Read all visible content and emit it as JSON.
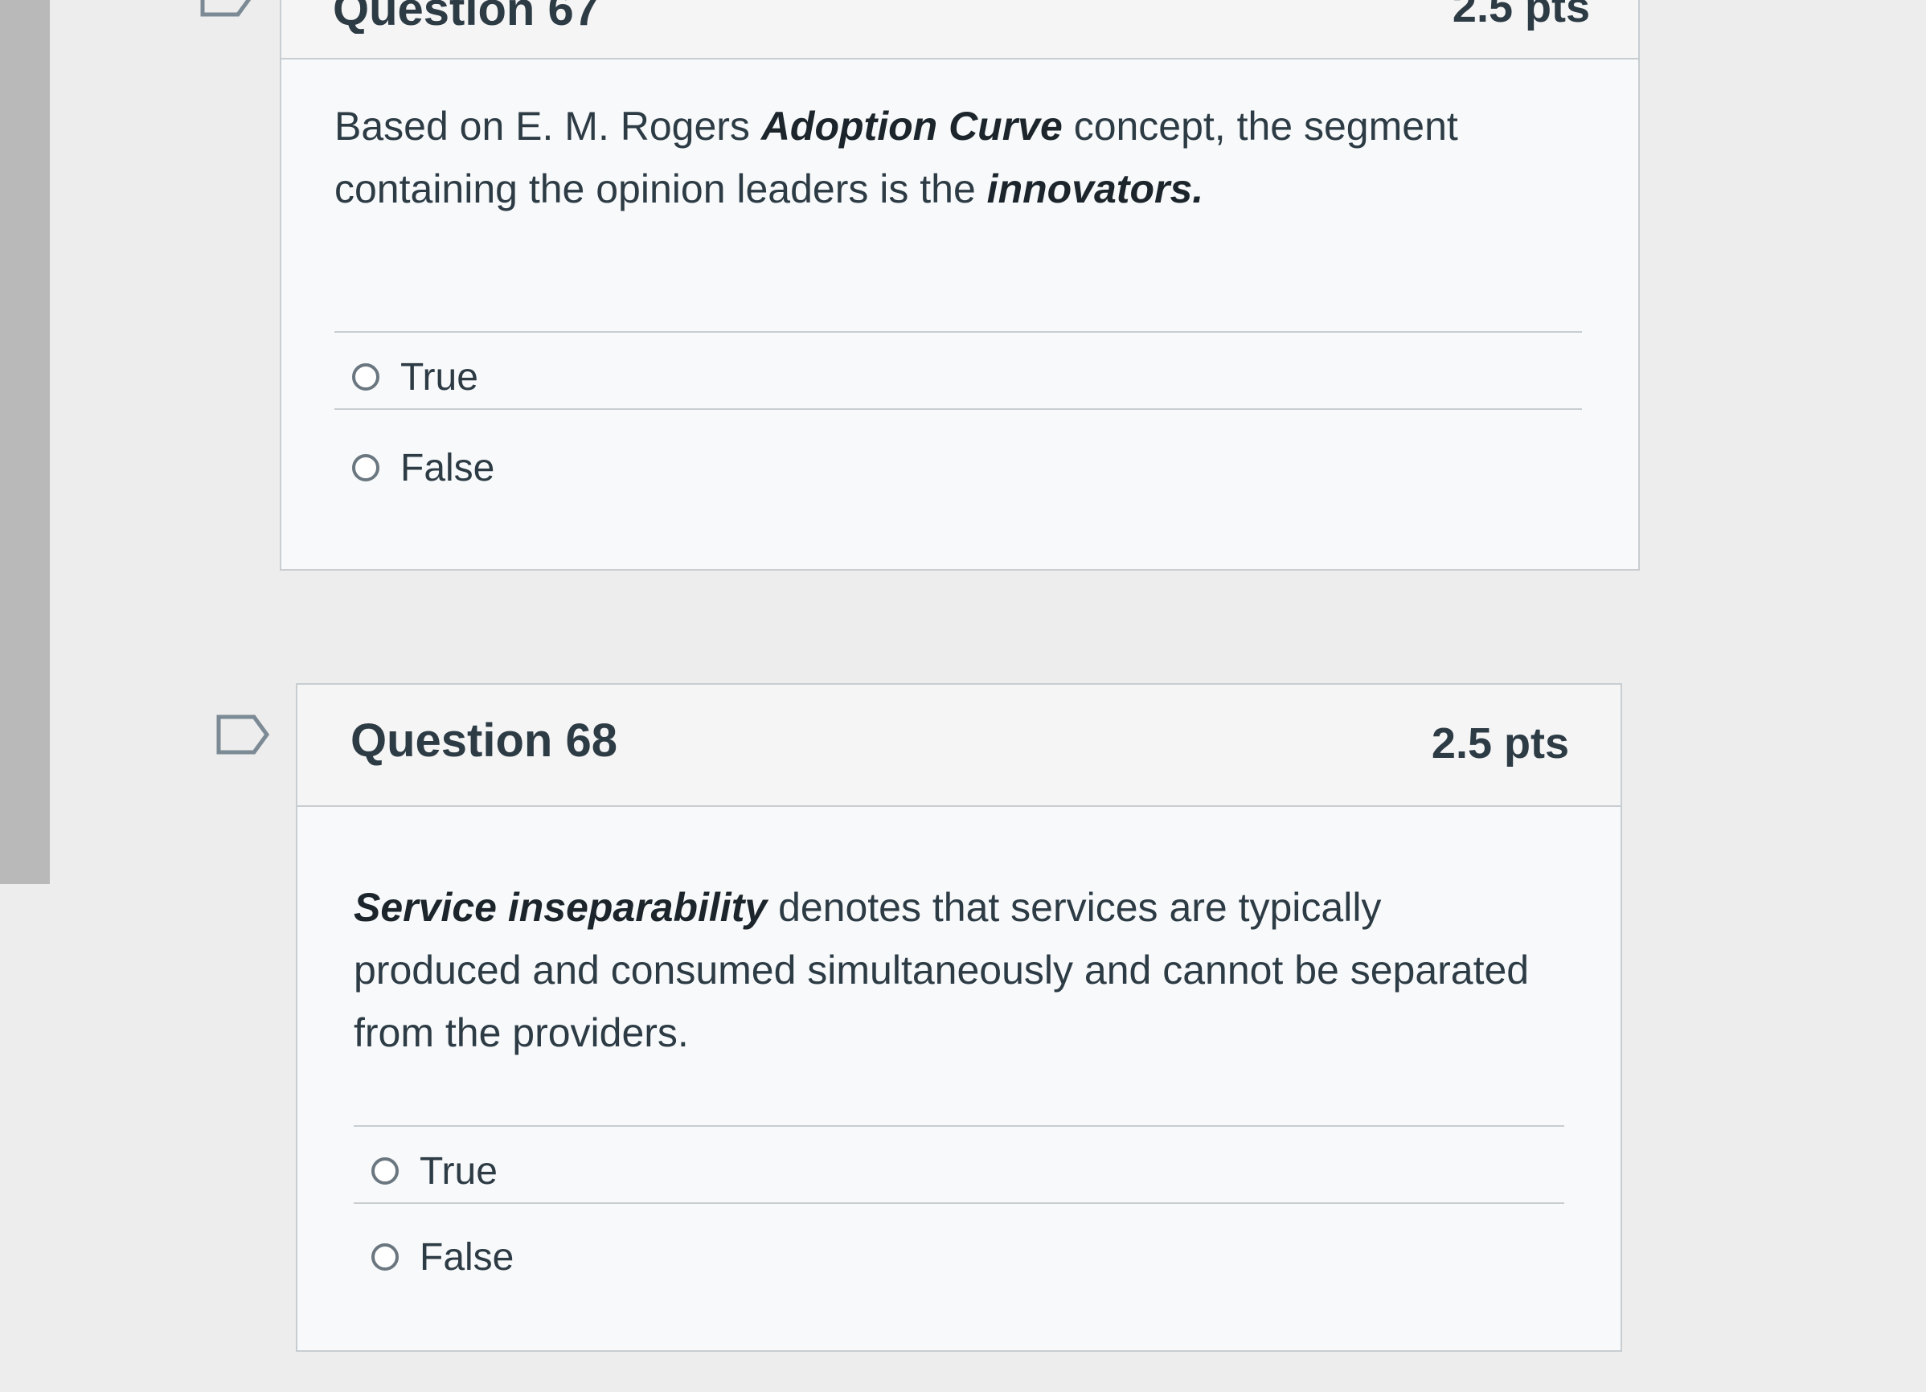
{
  "question_prev": {
    "title": "Question 67",
    "points": "2.5 pts",
    "text_parts": {
      "p1": "Based on E. M. Rogers ",
      "p2": "Adoption Curve",
      "p3": " concept, the segment containing the opinion leaders is the ",
      "p4": "innovators."
    },
    "answers": [
      {
        "label": "True"
      },
      {
        "label": "False"
      }
    ]
  },
  "question_68": {
    "title": "Question 68",
    "points": "2.5 pts",
    "text_parts": {
      "p1": "Service inseparability",
      "p2": " denotes that services are typically produced and consumed simultaneously and cannot be separated from the providers."
    },
    "answers": [
      {
        "label": "True"
      },
      {
        "label": "False"
      }
    ]
  }
}
